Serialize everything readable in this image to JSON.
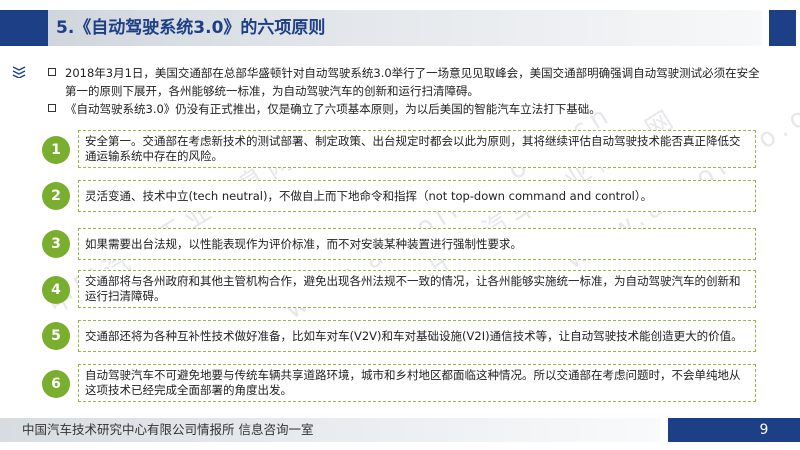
{
  "slide": {
    "title": "5.《自动驾驶系统3.0》的六项原则",
    "intro": [
      "2018年3月1日，美国交通部在总部华盛顿针对自动驾驶系统3.0举行了一场意见见取峰会，美国交通部明确强调自动驾驶测试必须在安全第一的原则下展开，各州能够统一标准，为自动驾驶汽车的创新和运行扫清障碍。",
      "《自动驾驶系统3.0》仍没有正式推出，仅是确立了六项基本原则，为以后美国的智能汽车立法打下基础。"
    ],
    "principles": [
      {
        "num": "1",
        "text": "安全第一。交通部在考虑新技术的测试部署、制定政策、出台规定时都会以此为原则，其将继续评估自动驾驶技术能否真正降低交通运输系统中存在的风险。"
      },
      {
        "num": "2",
        "text": "灵活变通、技术中立(tech neutral)，不做自上而下地命令和指挥（not top-down command and control）。"
      },
      {
        "num": "3",
        "text": "如果需要出台法规，以性能表现作为评价标准，而不对安装某种装置进行强制性要求。"
      },
      {
        "num": "4",
        "text": "交通部将与各州政府和其他主管机构合作，避免出现各州法规不一致的情况，让各州能够实施统一标准，为自动驾驶汽车的创新和运行扫清障碍。"
      },
      {
        "num": "5",
        "text": "交通部还将为各种互补性技术做好准备，比如车对车(V2V)和车对基础设施(V2I)通信技术等，让自动驾驶技术能创造更大的价值。"
      },
      {
        "num": "6",
        "text": "自动驾驶汽车不可避免地要与传统车辆共享道路环境，城市和乡村地区都面临这种情况。所以交通部在考虑问题时，不会单纯地从这项技术已经完成全面部署的角度出发。"
      }
    ],
    "watermark": [
      "中国汽车工业信息网",
      "www.autoinfo.org.cn"
    ]
  },
  "footer": {
    "org": "中国汽车技术研究中心有限公司情报所   信息咨询一室",
    "page_number": "9"
  },
  "colors": {
    "brand_blue": "#1d3f86",
    "circle_green": "#7aae2e",
    "box_border": "#94b94a"
  },
  "icons": {
    "corner": "stacked-lines-icon",
    "bullet": "square-bullet-icon"
  }
}
